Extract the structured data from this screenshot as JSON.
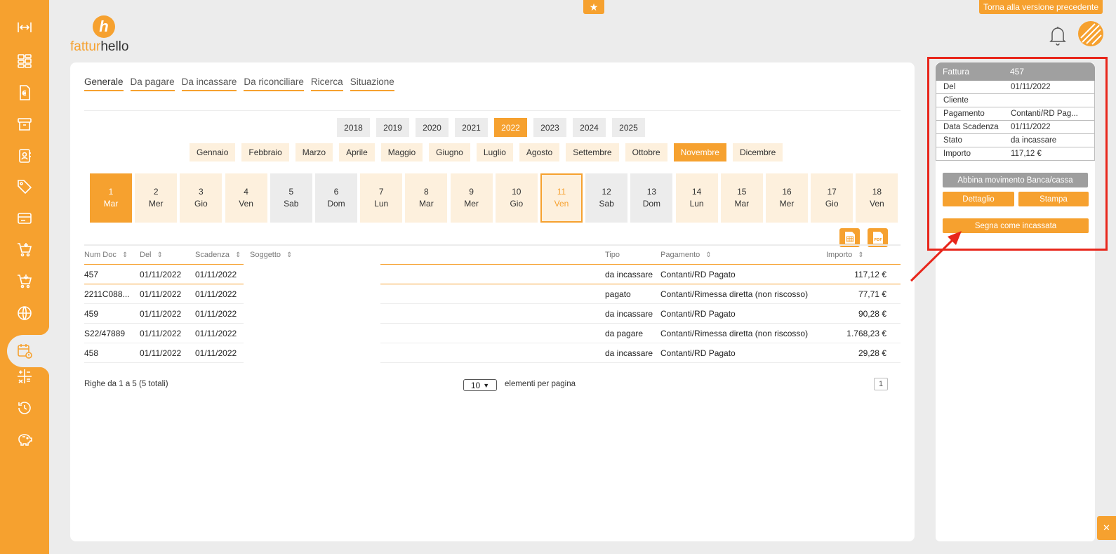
{
  "header": {
    "logo_part1": "fattur",
    "logo_part2": "hello",
    "logo_mark": "h",
    "back_button": "Torna alla versione precedente"
  },
  "sidebar": {
    "icons": [
      "expand-icon",
      "dashboard-icon",
      "invoice-euro-icon",
      "archive-icon",
      "contacts-icon",
      "tag-icon",
      "card-icon",
      "cart-add-icon",
      "cart-download-icon",
      "globe-icon",
      "calendar-alert-icon",
      "calculator-icon",
      "history-icon",
      "piggy-bank-icon"
    ],
    "active": "calendar-alert-icon"
  },
  "tabs": [
    "Generale",
    "Da pagare",
    "Da incassare",
    "Da riconciliare",
    "Ricerca",
    "Situazione"
  ],
  "active_tab": "Generale",
  "years": [
    "2018",
    "2019",
    "2020",
    "2021",
    "2022",
    "2023",
    "2024",
    "2025"
  ],
  "active_year": "2022",
  "months": [
    "Gennaio",
    "Febbraio",
    "Marzo",
    "Aprile",
    "Maggio",
    "Giugno",
    "Luglio",
    "Agosto",
    "Settembre",
    "Ottobre",
    "Novembre",
    "Dicembre"
  ],
  "active_month": "Novembre",
  "days": [
    {
      "num": "1",
      "name": "Mar"
    },
    {
      "num": "2",
      "name": "Mer"
    },
    {
      "num": "3",
      "name": "Gio"
    },
    {
      "num": "4",
      "name": "Ven"
    },
    {
      "num": "5",
      "name": "Sab"
    },
    {
      "num": "6",
      "name": "Dom"
    },
    {
      "num": "7",
      "name": "Lun"
    },
    {
      "num": "8",
      "name": "Mar"
    },
    {
      "num": "9",
      "name": "Mer"
    },
    {
      "num": "10",
      "name": "Gio"
    },
    {
      "num": "11",
      "name": "Ven"
    },
    {
      "num": "12",
      "name": "Sab"
    },
    {
      "num": "13",
      "name": "Dom"
    },
    {
      "num": "14",
      "name": "Lun"
    },
    {
      "num": "15",
      "name": "Mar"
    },
    {
      "num": "16",
      "name": "Mer"
    },
    {
      "num": "17",
      "name": "Gio"
    },
    {
      "num": "18",
      "name": "Ven"
    }
  ],
  "selected_day": "11",
  "table": {
    "columns": [
      "Num Doc",
      "Del",
      "Scadenza",
      "Soggetto",
      "Tipo",
      "Pagamento",
      "Importo"
    ],
    "rows": [
      {
        "num": "457",
        "del": "01/11/2022",
        "scad": "01/11/2022",
        "sogg": "",
        "tipo": "da incassare",
        "pag": "Contanti/RD Pagato",
        "imp": "117,12 €"
      },
      {
        "num": "2211C088...",
        "del": "01/11/2022",
        "scad": "01/11/2022",
        "sogg": "",
        "tipo": "pagato",
        "pag": "Contanti/Rimessa diretta (non riscosso)",
        "imp": "77,71 €"
      },
      {
        "num": "459",
        "del": "01/11/2022",
        "scad": "01/11/2022",
        "sogg": "",
        "tipo": "da incassare",
        "pag": "Contanti/RD Pagato",
        "imp": "90,28 €"
      },
      {
        "num": "S22/47889",
        "del": "01/11/2022",
        "scad": "01/11/2022",
        "sogg": "",
        "tipo": "da pagare",
        "pag": "Contanti/Rimessa diretta (non riscosso)",
        "imp": "1.768,23 €"
      },
      {
        "num": "458",
        "del": "01/11/2022",
        "scad": "01/11/2022",
        "sogg": "",
        "tipo": "da incassare",
        "pag": "Contanti/RD Pagato",
        "imp": "29,28 €"
      }
    ]
  },
  "footer": {
    "rows_info": "Righe da 1 a 5 (5 totali)",
    "per_page": "10",
    "per_page_label": "elementi per pagina",
    "page": "1"
  },
  "detail": {
    "header_key": "Fattura",
    "header_value": "457",
    "fields": [
      {
        "k": "Del",
        "v": "01/11/2022"
      },
      {
        "k": "Cliente",
        "v": ""
      },
      {
        "k": "Pagamento",
        "v": "Contanti/RD Pag..."
      },
      {
        "k": "Data Scadenza",
        "v": "01/11/2022"
      },
      {
        "k": "Stato",
        "v": "da incassare"
      },
      {
        "k": "Importo",
        "v": "117,12 €"
      }
    ],
    "btn_match": "Abbina movimento Banca/cassa",
    "btn_detail": "Dettaglio",
    "btn_print": "Stampa",
    "btn_mark": "Segna come incassata"
  },
  "colors": {
    "accent": "#f6a12f",
    "accent_light": "#fdf0dd",
    "highlight": "#e8261b"
  }
}
